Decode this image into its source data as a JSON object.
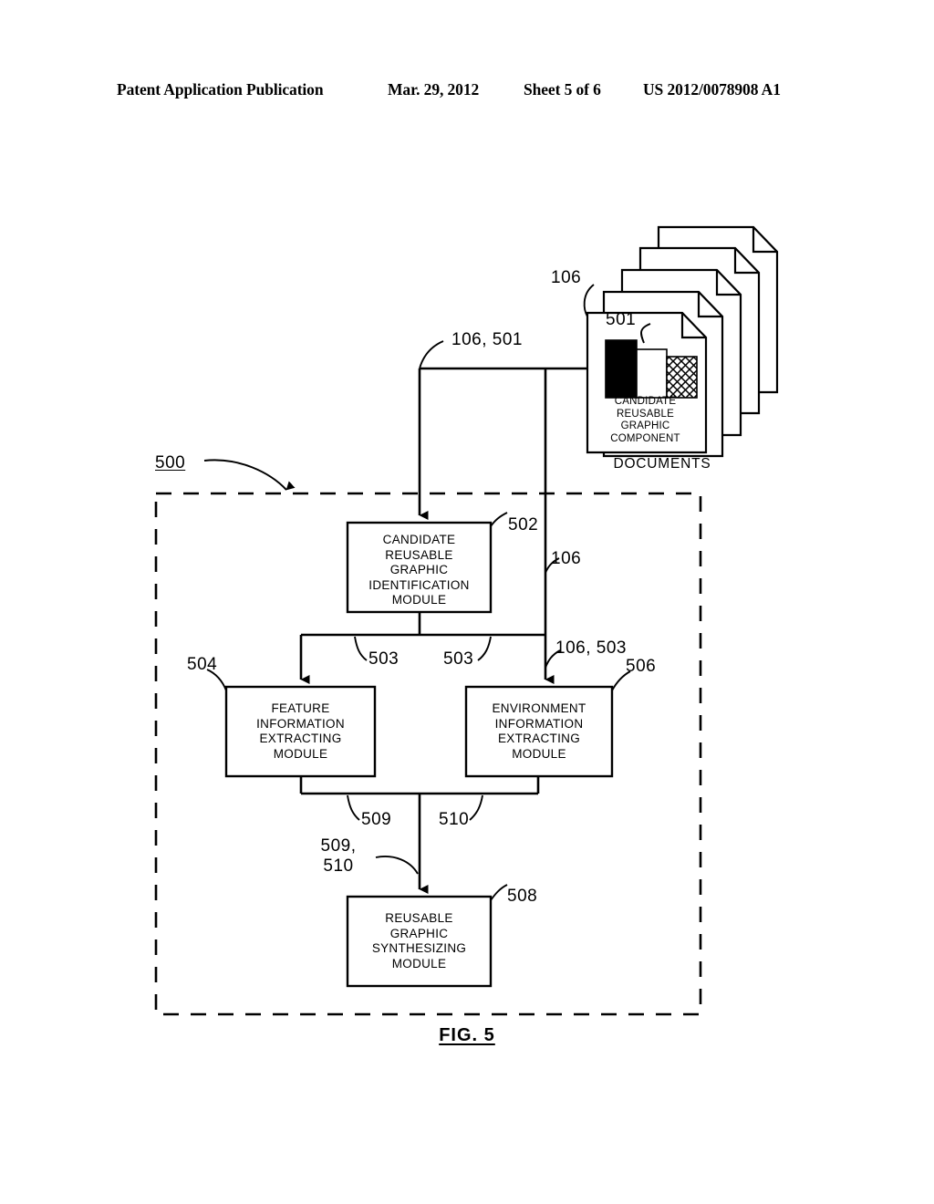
{
  "header": {
    "title": "Patent Application Publication",
    "date": "Mar. 29, 2012",
    "sheet": "Sheet 5 of 6",
    "publication_number": "US 2012/0078908 A1"
  },
  "figure": {
    "caption": "FIG. 5",
    "system_ref": "500",
    "boundary_style": "dashed"
  },
  "document_stack": {
    "ref": "106",
    "caption": "DOCUMENTS",
    "page_count": 5,
    "graphic": {
      "ref": "501",
      "caption": "CANDIDATE\nREUSABLE\nGRAPHIC\nCOMPONENT",
      "parts": [
        {
          "name": "black-bar",
          "fill": "#000000"
        },
        {
          "name": "white-bar",
          "fill": "#ffffff"
        },
        {
          "name": "crosshatch-bar",
          "fill": "crosshatch"
        }
      ]
    }
  },
  "modules": [
    {
      "ref": "502",
      "name": "candidate-reusable-graphic-identification-module",
      "label": "CANDIDATE\nREUSABLE\nGRAPHIC\nIDENTIFICATION\nMODULE"
    },
    {
      "ref": "504",
      "name": "feature-information-extracting-module",
      "label": "FEATURE\nINFORMATION\nEXTRACTING\nMODULE"
    },
    {
      "ref": "506",
      "name": "environment-information-extracting-module",
      "label": "ENVIRONMENT\nINFORMATION\nEXTRACTING\nMODULE"
    },
    {
      "ref": "508",
      "name": "reusable-graphic-synthesizing-module",
      "label": "REUSABLE\nGRAPHIC\nSYNTHESIZING\nMODULE"
    }
  ],
  "flow_labels": {
    "input_to_identification": "106, 501",
    "documents_branch": "106",
    "identification_out_left": "503",
    "identification_out_right": "503",
    "documents_to_environment": "106, 503",
    "feature_out": "509",
    "environment_out": "510",
    "merged_to_synthesizing": "509,\n510"
  },
  "colors": {
    "line": "#000000",
    "background": "#ffffff",
    "box_fill": "#ffffff",
    "graphic_black": "#000000"
  }
}
